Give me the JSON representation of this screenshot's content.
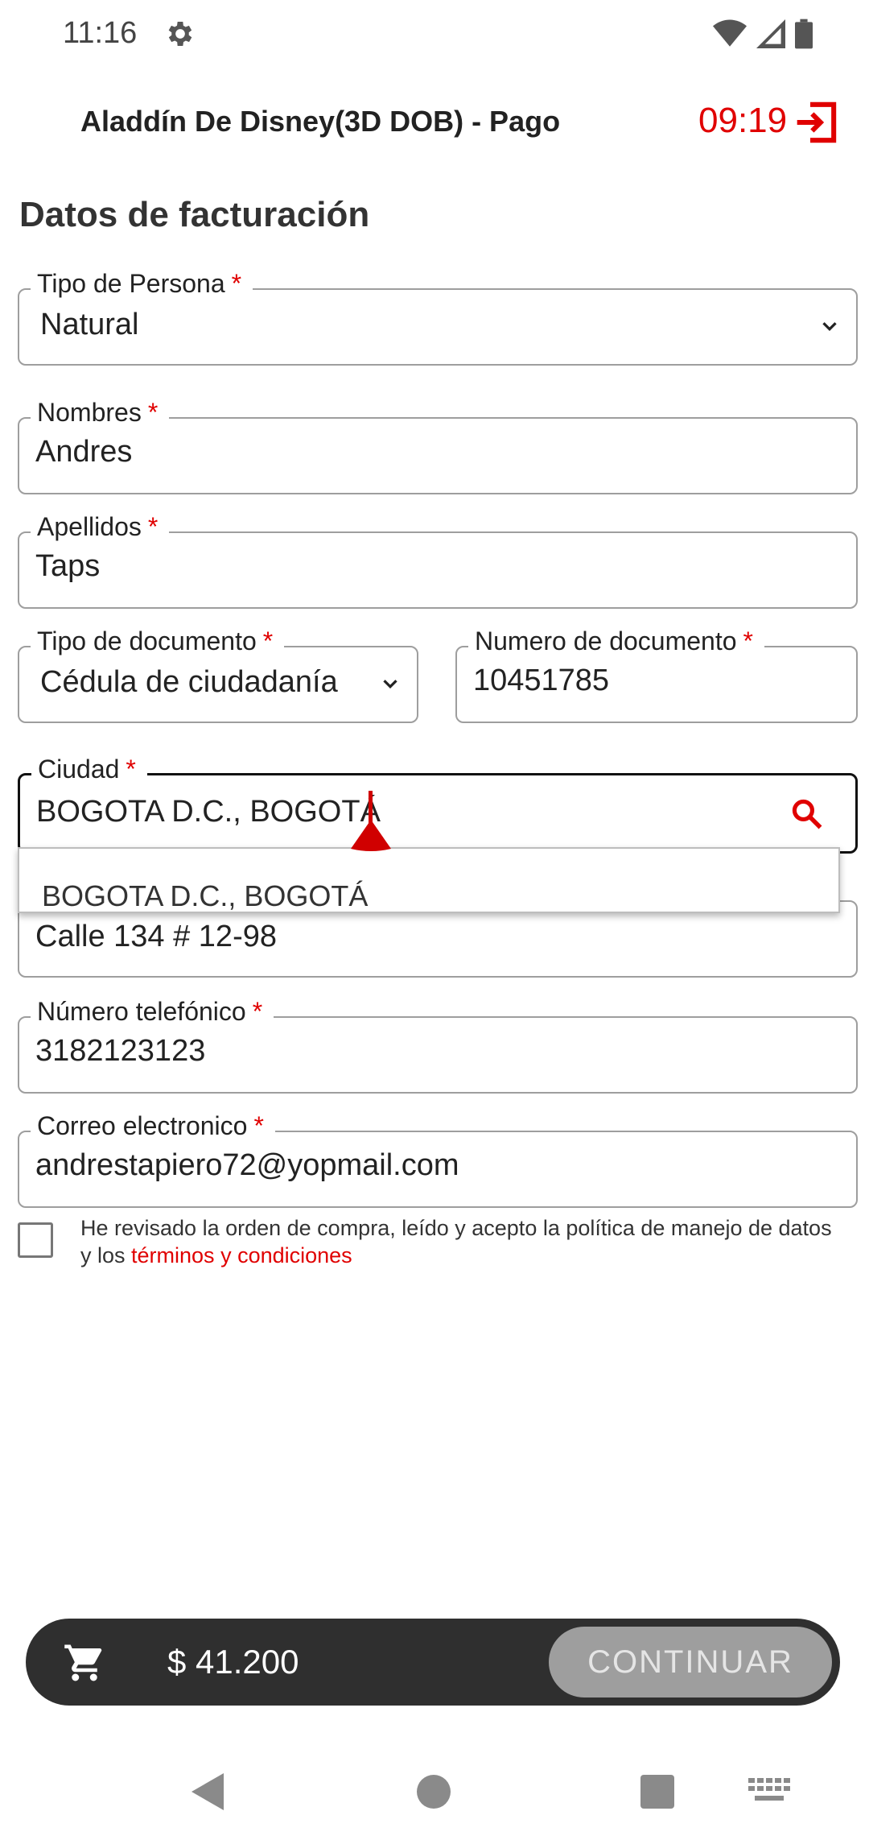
{
  "status_bar": {
    "time": "11:16"
  },
  "header": {
    "title": "Aladdín De Disney(3D DOB) - Pago",
    "timer": "09:19"
  },
  "section_title": "Datos de facturación",
  "form": {
    "tipo_persona": {
      "label": "Tipo de Persona",
      "value": "Natural"
    },
    "nombres": {
      "label": "Nombres",
      "value": "Andres"
    },
    "apellidos": {
      "label": "Apellidos",
      "value": "Taps"
    },
    "tipo_documento": {
      "label": "Tipo de documento",
      "value": "Cédula de ciudadanía"
    },
    "numero_documento": {
      "label": "Numero de documento",
      "value": "10451785"
    },
    "ciudad": {
      "label": "Ciudad",
      "value": "BOGOTA D.C., BOGOTÁ"
    },
    "direccion": {
      "value": "Calle 134 # 12-98"
    },
    "telefono": {
      "label": "Número telefónico",
      "value": "3182123123"
    },
    "correo": {
      "label": "Correo electronico",
      "value": "andrestapiero72@yopmail.com"
    },
    "required_marker": "*"
  },
  "city_suggestions": [
    "BOGOTA D.C., BOGOTÁ"
  ],
  "terms": {
    "text_before": "He revisado la orden de compra, leído y acepto la política de manejo de datos y los ",
    "link": "términos y condiciones"
  },
  "cart": {
    "price": "$ 41.200",
    "continue_label": "CONTINUAR"
  },
  "colors": {
    "accent": "#e00000",
    "cart_bar": "#2f2f2f",
    "button_disabled": "#9e9e9e"
  }
}
